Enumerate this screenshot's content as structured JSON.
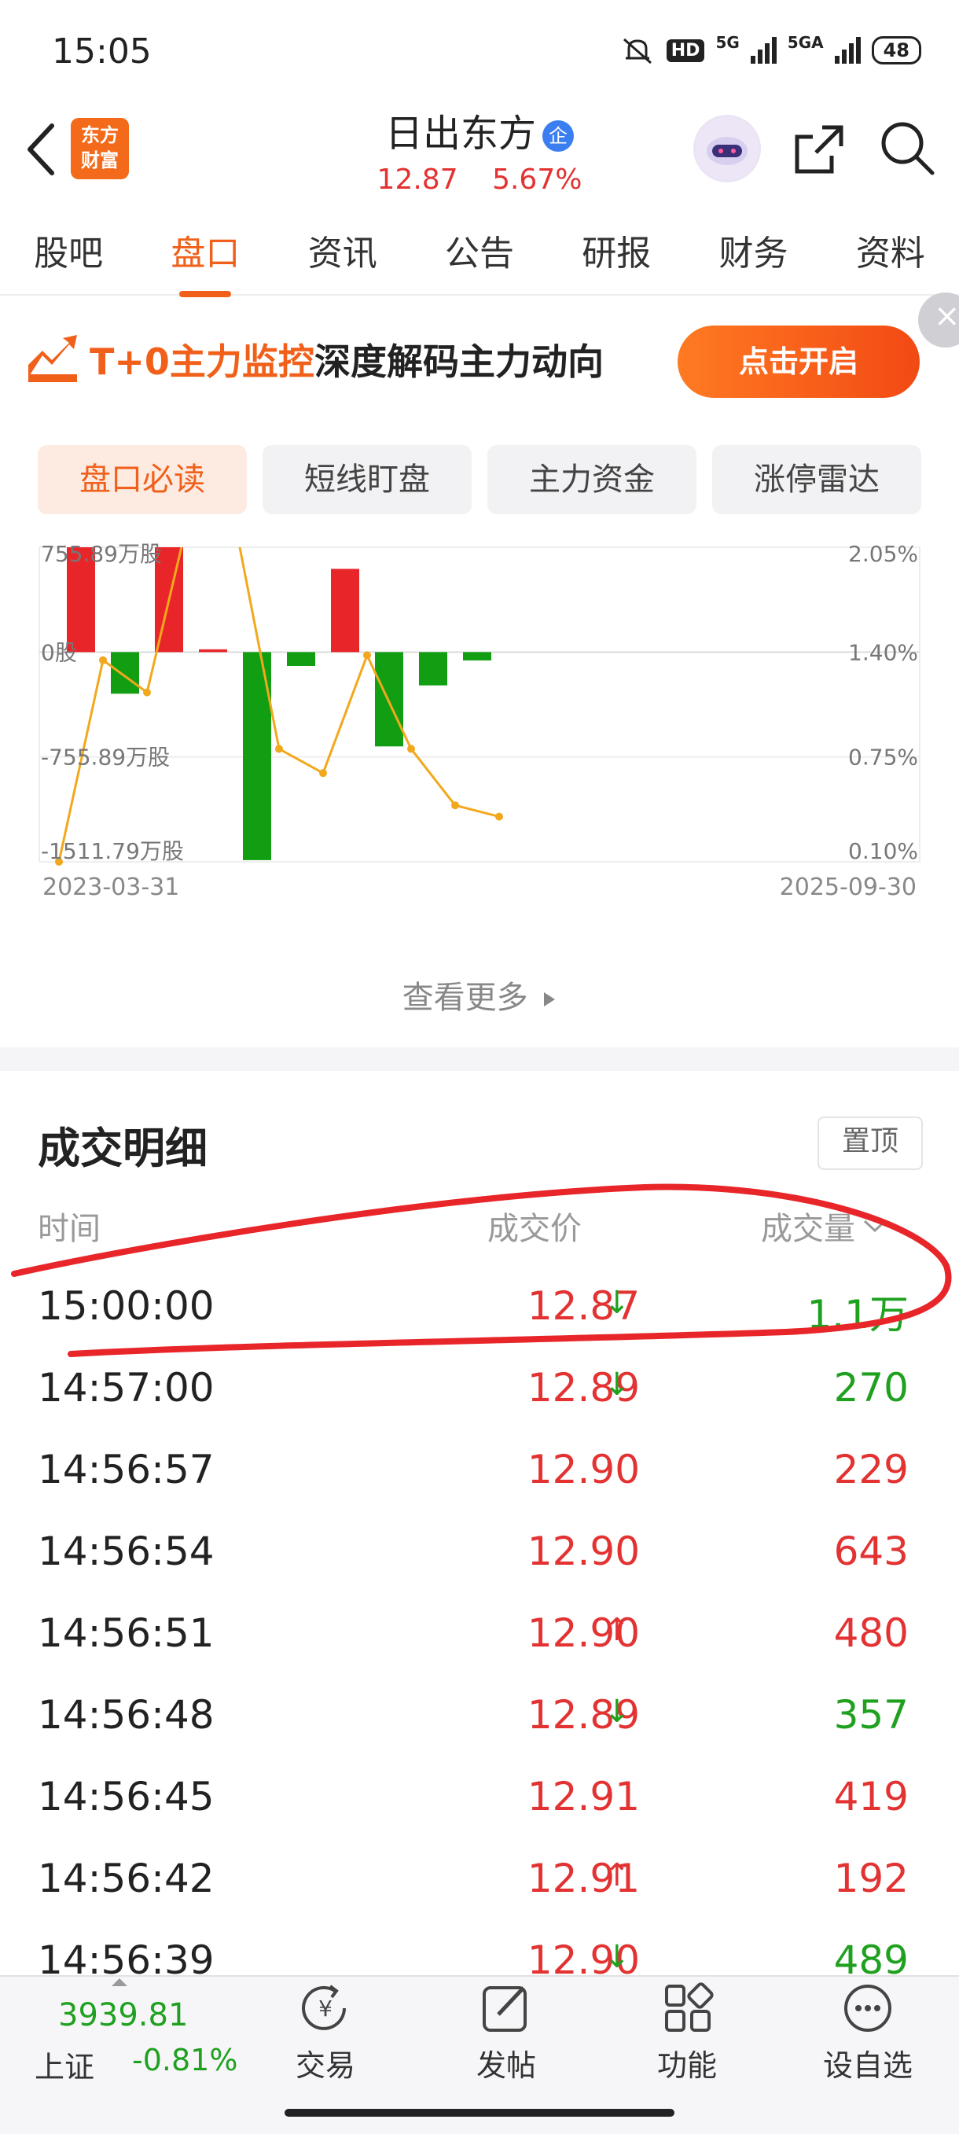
{
  "status": {
    "time": "15:05",
    "hd": "HD",
    "net1": "5G",
    "net2": "5GA",
    "battery": "48"
  },
  "header": {
    "title": "日出东方",
    "badge": "企",
    "logo_line1": "东方",
    "logo_line2": "财富",
    "price": "12.87",
    "change_pct": "5.67%"
  },
  "tabs": [
    "股吧",
    "盘口",
    "资讯",
    "公告",
    "研报",
    "财务",
    "资料"
  ],
  "active_tab": "盘口",
  "banner": {
    "highlight": "T+0主力监控",
    "text": "深度解码主力动向",
    "button": "点击开启"
  },
  "subtabs": [
    "盘口必读",
    "短线盯盘",
    "主力资金",
    "涨停雷达"
  ],
  "chart_data": {
    "type": "bar",
    "left_axis_ticks": [
      "755.89万股",
      "0股",
      "-755.89万股",
      "-1511.79万股"
    ],
    "right_axis_ticks": [
      "2.05%",
      "1.40%",
      "0.75%",
      "0.10%"
    ],
    "x_start": "2023-03-31",
    "x_end": "2025-09-30",
    "ylim_left": [
      -1511.79,
      755.89
    ],
    "ylim_right": [
      0.1,
      2.05
    ],
    "bars": [
      800,
      -300,
      900,
      20,
      -1500,
      -100,
      600,
      -680,
      -240,
      -60
    ],
    "bar_colors": [
      "#e8262a",
      "#129e12",
      "#e8262a",
      "#e8262a",
      "#129e12",
      "#129e12",
      "#e8262a",
      "#129e12",
      "#129e12",
      "#129e12"
    ],
    "line": [
      0.1,
      1.35,
      1.15,
      2.3,
      2.2,
      0.8,
      0.65,
      1.38,
      0.8,
      0.45,
      0.38
    ],
    "line_color": "#f2a81c"
  },
  "more": "查看更多",
  "detail": {
    "title": "成交明细",
    "pin": "置顶",
    "col_time": "时间",
    "col_price": "成交价",
    "col_volume": "成交量",
    "rows": [
      {
        "time": "15:00:00",
        "price": "12.87",
        "arrow": "↓",
        "volume": "1.1万",
        "vol_color": "green"
      },
      {
        "time": "14:57:00",
        "price": "12.89",
        "arrow": "↓",
        "volume": "270",
        "vol_color": "green"
      },
      {
        "time": "14:56:57",
        "price": "12.90",
        "arrow": "",
        "volume": "229",
        "vol_color": "red"
      },
      {
        "time": "14:56:54",
        "price": "12.90",
        "arrow": "",
        "volume": "643",
        "vol_color": "red"
      },
      {
        "time": "14:56:51",
        "price": "12.90",
        "arrow": "↑",
        "volume": "480",
        "vol_color": "red"
      },
      {
        "time": "14:56:48",
        "price": "12.89",
        "arrow": "↓",
        "volume": "357",
        "vol_color": "green"
      },
      {
        "time": "14:56:45",
        "price": "12.91",
        "arrow": "",
        "volume": "419",
        "vol_color": "red"
      },
      {
        "time": "14:56:42",
        "price": "12.91",
        "arrow": "↑",
        "volume": "192",
        "vol_color": "red"
      },
      {
        "time": "14:56:39",
        "price": "12.90",
        "arrow": "↓",
        "volume": "489",
        "vol_color": "green"
      }
    ]
  },
  "bottom": {
    "index_value": "3939.81",
    "index_name": "上证",
    "index_change": "-0.81%",
    "items": [
      "交易",
      "发帖",
      "功能",
      "设自选"
    ]
  }
}
